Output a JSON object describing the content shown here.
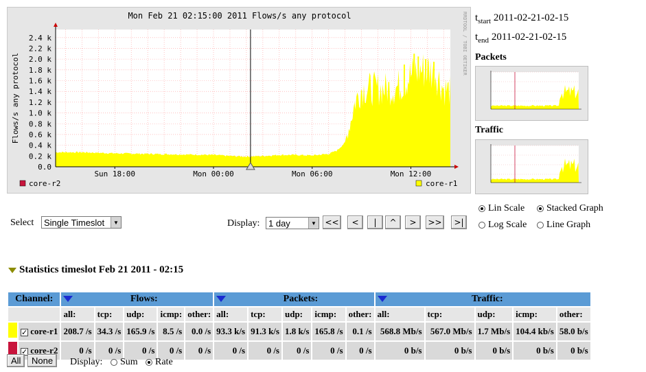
{
  "graph": {
    "title": "Mon Feb 21 02:15:00 2011 Flows/s any protocol",
    "ylabel": "Flows/s any protocol",
    "watermark": "RRDTOOL / TOBI OETIKER",
    "legend_left": "core-r2",
    "legend_right": "core-r1",
    "colors": {
      "core_r1": "#ffff00",
      "core_r2": "#c8143c",
      "grid": "#ff9999",
      "bg": "#ffffff"
    }
  },
  "chart_data": {
    "type": "area",
    "title": "Mon Feb 21 02:15:00 2011 Flows/s any protocol",
    "ylabel": "Flows/s any protocol",
    "ylim": [
      0,
      2.55
    ],
    "y_ticks": [
      "0.0",
      "0.2 k",
      "0.4 k",
      "0.6 k",
      "0.8 k",
      "1.0 k",
      "1.2 k",
      "1.4 k",
      "1.6 k",
      "1.8 k",
      "2.0 k",
      "2.2 k",
      "2.4 k"
    ],
    "x_ticks": [
      {
        "label": "Sun 18:00",
        "hour": -6
      },
      {
        "label": "Mon 00:00",
        "hour": 0
      },
      {
        "label": "Mon 06:00",
        "hour": 6
      },
      {
        "label": "Mon 12:00",
        "hour": 12
      }
    ],
    "x_range_hours": [
      -9.6,
      14.4
    ],
    "cursor_hour": 2.25,
    "series": [
      {
        "name": "core-r1",
        "color": "#ffff00",
        "points": [
          [
            -9.6,
            0.27
          ],
          [
            -8,
            0.27
          ],
          [
            -6,
            0.25
          ],
          [
            -4,
            0.24
          ],
          [
            -2,
            0.23
          ],
          [
            0,
            0.22
          ],
          [
            1,
            0.2
          ],
          [
            2,
            0.19
          ],
          [
            3,
            0.2
          ],
          [
            4,
            0.22
          ],
          [
            5,
            0.22
          ],
          [
            6,
            0.21
          ],
          [
            7,
            0.24
          ],
          [
            7.5,
            0.3
          ],
          [
            8,
            0.45
          ],
          [
            8.3,
            0.8
          ],
          [
            8.6,
            1.2
          ],
          [
            9,
            1.45
          ],
          [
            10,
            1.45
          ],
          [
            11,
            1.45
          ],
          [
            11.5,
            1.55
          ],
          [
            12,
            1.7
          ],
          [
            12.5,
            1.8
          ],
          [
            13,
            1.8
          ],
          [
            13.5,
            1.75
          ],
          [
            14,
            1.45
          ],
          [
            14.4,
            1.4
          ]
        ]
      },
      {
        "name": "core-r2",
        "color": "#c8143c",
        "points": [
          [
            -9.6,
            0
          ],
          [
            14.4,
            0
          ]
        ]
      }
    ]
  },
  "right": {
    "tstart_label": "start",
    "tstart_value": "2011-02-21-02-15",
    "tend_label": "end",
    "tend_value": "2011-02-21-02-15",
    "packets_title": "Packets",
    "traffic_title": "Traffic",
    "lin_scale": "Lin Scale",
    "log_scale": "Log Scale",
    "stacked_graph": "Stacked Graph",
    "line_graph": "Line Graph"
  },
  "controls": {
    "select_label": "Select",
    "select_value": "Single Timeslot",
    "display_label": "Display:",
    "display_value": "1 day",
    "nav": [
      "<<",
      "<",
      "|",
      "^",
      ">",
      ">>",
      ">|"
    ]
  },
  "stats": {
    "header": "Statistics timeslot Feb 21 2011 - 02:15",
    "channel_label": "Channel:",
    "flows_label": "Flows:",
    "packets_label": "Packets:",
    "traffic_label": "Traffic:",
    "flow_cols": [
      "all:",
      "tcp:",
      "udp:",
      "icmp:",
      "other:"
    ],
    "packet_cols": [
      "all:",
      "tcp:",
      "udp:",
      "icmp:",
      "other:"
    ],
    "traffic_cols": [
      "all:",
      "tcp:",
      "udp:",
      "icmp:",
      "other:"
    ],
    "rows": [
      {
        "name": "core-r1",
        "color": "#ffff00",
        "flows": [
          "208.7 /s",
          "34.3 /s",
          "165.9 /s",
          "8.5 /s",
          "0.0 /s"
        ],
        "packets": [
          "93.3 k/s",
          "91.3 k/s",
          "1.8 k/s",
          "165.8 /s",
          "0.1 /s"
        ],
        "traffic": [
          "568.8 Mb/s",
          "567.0 Mb/s",
          "1.7 Mb/s",
          "104.4 kb/s",
          "58.0 b/s"
        ]
      },
      {
        "name": "core-r2",
        "color": "#c8143c",
        "flows": [
          "0 /s",
          "0 /s",
          "0 /s",
          "0 /s",
          "0 /s"
        ],
        "packets": [
          "0 /s",
          "0 /s",
          "0 /s",
          "0 /s",
          "0 /s"
        ],
        "traffic": [
          "0 b/s",
          "0 b/s",
          "0 b/s",
          "0 b/s",
          "0 b/s"
        ]
      }
    ],
    "all_button": "All",
    "none_button": "None",
    "display_label": "Display:",
    "sum_label": "Sum",
    "rate_label": "Rate"
  }
}
